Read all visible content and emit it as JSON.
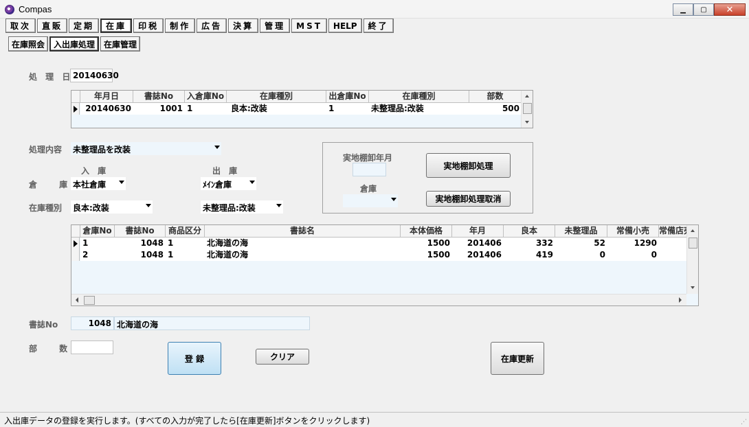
{
  "window": {
    "title": "Compas"
  },
  "menu": [
    {
      "label": "取次"
    },
    {
      "label": "直販"
    },
    {
      "label": "定期"
    },
    {
      "label": "在庫"
    },
    {
      "label": "印税"
    },
    {
      "label": "制作"
    },
    {
      "label": "広告"
    },
    {
      "label": "決算"
    },
    {
      "label": "管理"
    },
    {
      "label": "MST"
    },
    {
      "label": "HELP"
    },
    {
      "label": "終了"
    }
  ],
  "submenu": [
    {
      "label": "在庫照会"
    },
    {
      "label": "入出庫処理"
    },
    {
      "label": "在庫管理"
    }
  ],
  "form": {
    "date_label": "処 理 日",
    "date_value": "20140630",
    "process_label": "処理内容",
    "process_value": "未整理品を改装",
    "in_header": "入 庫",
    "out_header": "出 庫",
    "warehouse_label": "倉 庫",
    "in_warehouse": "本社倉庫",
    "out_warehouse": "ﾒｲﾝ倉庫",
    "stock_type_label": "在庫種別",
    "in_stock_type": "良本:改装",
    "out_stock_type": "未整理品:改装",
    "book_no_label": "書誌No",
    "book_no": "1048",
    "book_name": "北海道の海",
    "qty_label": "部 数",
    "qty_value": ""
  },
  "top_grid": {
    "headers": [
      "年月日",
      "書誌No",
      "入倉庫No",
      "在庫種別",
      "出倉庫No",
      "在庫種別",
      "部数"
    ],
    "rows": [
      [
        "20140630",
        "1001",
        "1",
        "良本:改装",
        "1",
        "未整理品:改装",
        "500"
      ]
    ]
  },
  "inventory_panel": {
    "ym_label": "実地棚卸年月",
    "ym_value": "",
    "warehouse_label": "倉庫",
    "warehouse_value": "",
    "process_button": "実地棚卸処理",
    "cancel_button": "実地棚卸処理取消"
  },
  "bottom_grid": {
    "headers": [
      "倉庫No",
      "書誌No",
      "商品区分",
      "書誌名",
      "本体価格",
      "年月",
      "良本",
      "未整理品",
      "常備小売",
      "常備店売"
    ],
    "rows": [
      [
        "1",
        "1048",
        "1",
        "北海道の海",
        "1500",
        "201406",
        "332",
        "52",
        "1290",
        ""
      ],
      [
        "2",
        "1048",
        "1",
        "北海道の海",
        "1500",
        "201406",
        "419",
        "0",
        "0",
        ""
      ]
    ]
  },
  "buttons": {
    "register": "登 録",
    "clear": "クリア",
    "update": "在庫更新"
  },
  "status_text": "入出庫データの登録を実行します。(すべての入力が完了したら[在庫更新]ボタンをクリックします)"
}
